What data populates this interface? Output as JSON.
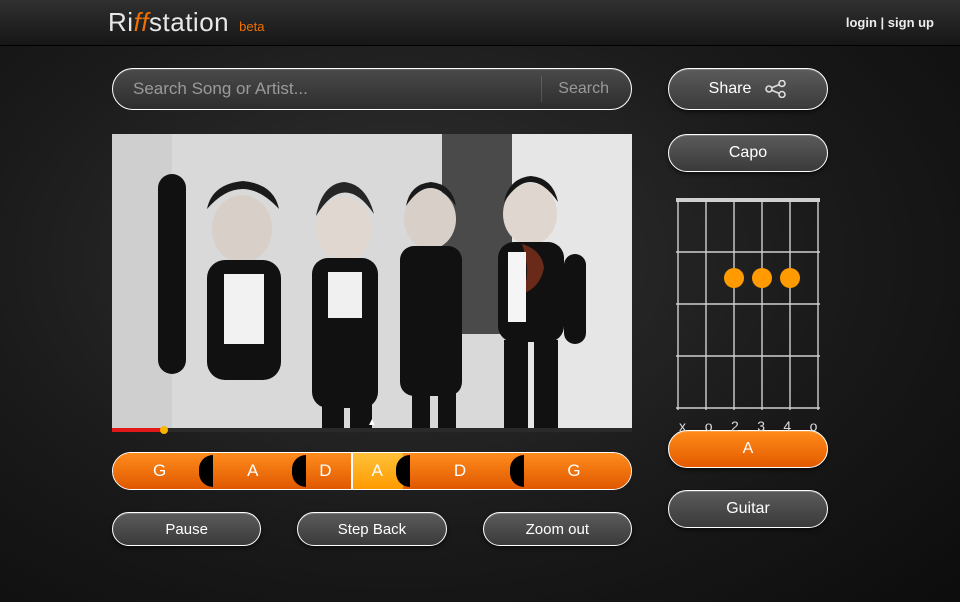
{
  "header": {
    "brand_pre": "Ri",
    "brand_ff": "ff",
    "brand_post": "station",
    "brand_tag": "beta",
    "login": "login",
    "sep": " | ",
    "signup": "sign up"
  },
  "search": {
    "placeholder": "Search Song or Artist...",
    "button": "Search"
  },
  "share": {
    "label": "Share"
  },
  "capo": {
    "label": "Capo"
  },
  "chords": {
    "segments": [
      {
        "label": "G",
        "w": 18,
        "bright": false
      },
      {
        "label": "A",
        "w": 18,
        "bright": false
      },
      {
        "label": "D",
        "w": 10,
        "bright": false
      },
      {
        "label": "A",
        "w": 10,
        "bright": true
      },
      {
        "label": "D",
        "w": 22,
        "bright": false
      },
      {
        "label": "G",
        "w": 22,
        "bright": false
      }
    ]
  },
  "transport": {
    "pause": "Pause",
    "step_back": "Step Back",
    "zoom_out": "Zoom out"
  },
  "current_chord": {
    "name": "A"
  },
  "instrument": {
    "label": "Guitar"
  },
  "fret_labels": [
    "x",
    "o",
    "2",
    "3",
    "4",
    "o"
  ],
  "chord_diagram": {
    "dots": [
      {
        "string": 3,
        "fret": 2
      },
      {
        "string": 4,
        "fret": 2
      },
      {
        "string": 5,
        "fret": 2
      }
    ]
  }
}
